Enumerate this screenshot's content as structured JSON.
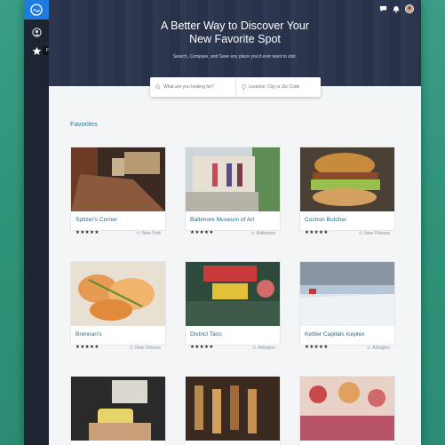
{
  "hero": {
    "title_line1": "A Better Way to Discover Your",
    "title_line2": "New Favorite Spot",
    "subtitle": "Search, Compare, and Save any place you'd ever want to visit."
  },
  "search": {
    "query_placeholder": "What are you looking for?",
    "location_placeholder": "Location: City or Zip Code"
  },
  "sidebar": {
    "tooltip": "Favorites",
    "items": [
      {
        "icon": "user-circle-icon"
      },
      {
        "icon": "star-icon"
      }
    ]
  },
  "header_icons": [
    "chat-icon",
    "bell-icon",
    "avatar"
  ],
  "section_title": "Favorites",
  "colors": {
    "sidebar": "#1d2533",
    "brand": "#1e7be0",
    "accent_text": "#2a6a86",
    "background": "#2f9479"
  },
  "cards": [
    {
      "name": "Spitzer's Corner",
      "stars": "★★★★★",
      "location": "New York",
      "rating": 4.5
    },
    {
      "name": "Baltimore Museum of Art",
      "stars": "★★★★★",
      "location": "Baltimore",
      "rating": 4.5
    },
    {
      "name": "Cochon Butcher",
      "stars": "★★★★★",
      "location": "New Orleans",
      "rating": 5
    },
    {
      "name": "Brennan's",
      "stars": "★★★★★",
      "location": "New Orleans",
      "rating": 5
    },
    {
      "name": "District Taco",
      "stars": "★★★★★",
      "location": "Arlington",
      "rating": 4.5
    },
    {
      "name": "Kettler Capitals Iceplex",
      "stars": "★★★★★",
      "location": "Arlington",
      "rating": 4.5
    },
    {
      "name": "",
      "stars": "",
      "location": ""
    },
    {
      "name": "",
      "stars": "",
      "location": ""
    },
    {
      "name": "",
      "stars": "",
      "location": ""
    }
  ]
}
